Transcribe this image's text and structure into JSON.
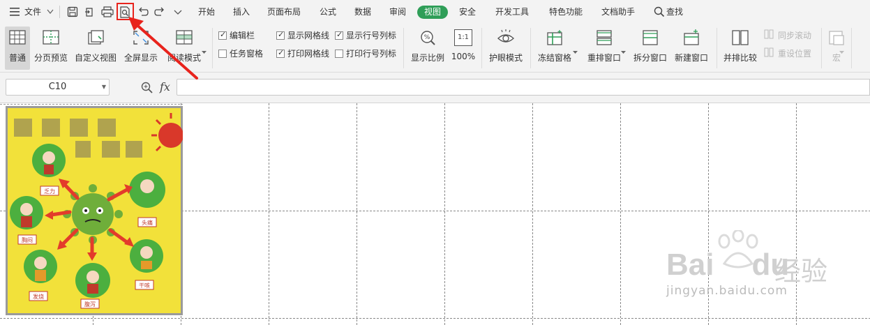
{
  "menu": {
    "file": "文件",
    "tabs": [
      "开始",
      "插入",
      "页面布局",
      "公式",
      "数据",
      "审阅",
      "视图",
      "安全",
      "开发工具",
      "特色功能",
      "文档助手"
    ],
    "active_tab": "视图",
    "search": "查找"
  },
  "ribbon": {
    "normal": "普通",
    "page_break_preview": "分页预览",
    "custom_view": "自定义视图",
    "full_screen": "全屏显示",
    "reading_mode": "阅读模式",
    "edit_bar": "编辑栏",
    "task_pane": "任务窗格",
    "show_gridlines": "显示网格线",
    "print_gridlines": "打印网格线",
    "show_headings": "显示行号列标",
    "print_headings": "打印行号列标",
    "zoom": "显示比例",
    "zoom_100": "100%",
    "zoom_100_icon_text": "1:1",
    "eye_protection": "护眼模式",
    "freeze_panes": "冻结窗格",
    "arrange_windows": "重排窗口",
    "split_window": "拆分窗口",
    "new_window": "新建窗口",
    "side_by_side": "并排比较",
    "sync_scroll": "同步滚动",
    "reset_position": "重设位置",
    "macro": "宏"
  },
  "checkboxes": {
    "edit_bar": true,
    "task_pane": false,
    "show_gridlines": true,
    "print_gridlines": true,
    "show_headings": true,
    "print_headings": false
  },
  "formula_bar": {
    "cell_ref": "C10",
    "fx": "fx",
    "value": ""
  },
  "poster": {
    "labels": [
      "乏力",
      "头痛",
      "胸闷",
      "发烧",
      "腹泻",
      "干咳"
    ]
  },
  "watermark": {
    "brand": "Bai",
    "brand2": "du",
    "cn": "经验",
    "url": "jingyan.baidu.com"
  },
  "colors": {
    "active_tab": "#2f9e58",
    "highlight": "#e8231c",
    "poster_bg": "#f2e13a"
  }
}
